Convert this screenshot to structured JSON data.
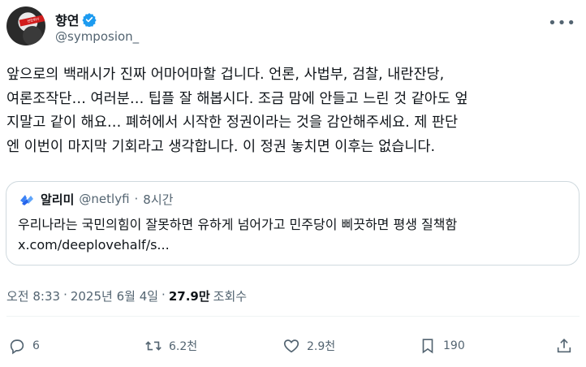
{
  "author": {
    "display_name": "향연",
    "handle": "@symposion_",
    "verified": true,
    "avatar_band_text": "반란위키"
  },
  "tweet": {
    "text": "앞으로의 백래시가 진짜 어마어마할 겁니다. 언론, 사법부, 검찰, 내란잔당,\n여론조작단… 여러분… 팁플 잘 해봅시다. 조금 맘에 안들고 느린 것 같아도 엎\n지말고 같이 해요… 폐허에서 시작한 정권이라는 것을 감안해주세요. 제 판단\n엔 이번이 마지막 기회라고 생각합니다. 이 정권 놓치면 이후는 없습니다."
  },
  "quote": {
    "name": "알리미",
    "handle": "@netlyfi",
    "separator": "·",
    "time": "8시간",
    "text_line1": "우리나라는 국민의힘이 잘못하면 유하게 넘어가고 민주당이 삐끗하면 평생 질책함",
    "text_line2": "x.com/deeplovehalf/s..."
  },
  "meta": {
    "time": "오전 8:33",
    "sep1": "·",
    "date": "2025년 6월 4일",
    "sep2": "·",
    "views": "27.9만",
    "views_label": "조회수"
  },
  "actions": {
    "replies": "6",
    "retweets": "6.2천",
    "likes": "2.9천",
    "bookmarks": "190"
  },
  "colors": {
    "verified": "#1d9bf0",
    "secondary_text": "#536471",
    "border": "#cfd9de"
  }
}
